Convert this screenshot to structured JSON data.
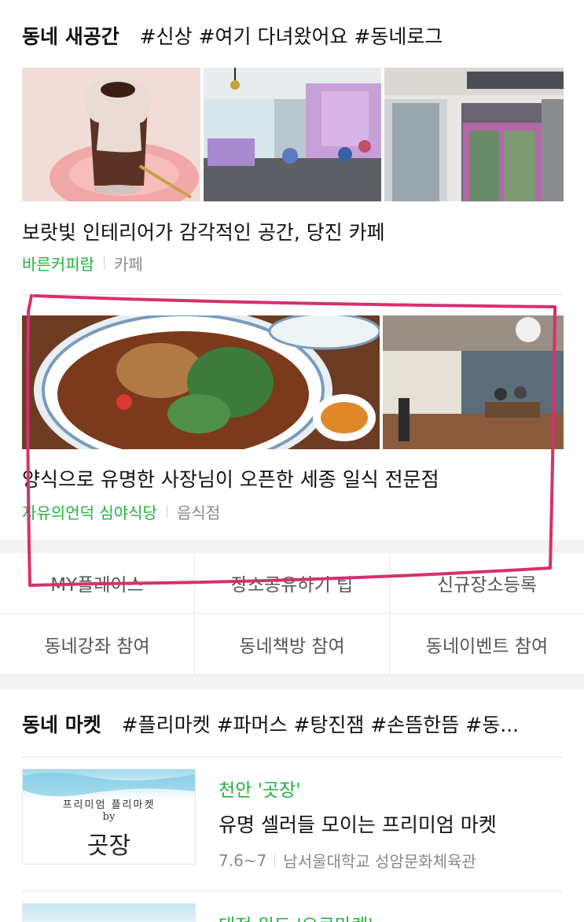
{
  "new_space": {
    "title": "동네 새공간",
    "tags": "#신상 #여기 다녀왔어요 #동네로그",
    "cards": [
      {
        "title": "보랏빛 인테리어가 감각적인 공간, 당진 카페",
        "place": "바른커피람",
        "category": "카페",
        "images": [
          "cafe-drink-photo",
          "purple-interior-photo",
          "storefront-photo"
        ]
      },
      {
        "title": "양식으로 유명한 사장님이 오픈한 세종 일식 전문점",
        "place": "자유의언덕 심야식당",
        "category": "음식점",
        "images": [
          "curry-dish-photo",
          "restaurant-interior-photo"
        ]
      }
    ]
  },
  "menu_grid": {
    "row1": [
      "MY플레이스",
      "장소공유하기 팁",
      "신규장소등록"
    ],
    "row2": [
      "동네강좌 참여",
      "동네책방 참여",
      "동네이벤트 참여"
    ]
  },
  "market": {
    "title": "동네 마켓",
    "tags": "#플리마켓 #파머스 #탕진잼 #손뜸한뜸 #동...",
    "items": [
      {
        "category": "천안 '곳장'",
        "title": "유명 셀러들 모이는 프리미엄 마켓",
        "date": "7.6~7",
        "venue": "남서울대학교 성암문화체육관",
        "thumb_line1": "프리미엄 플리마켓",
        "thumb_line2": "by",
        "thumb_line3": "곳장"
      },
      {
        "category": "대전 원도 '으로마켓'"
      }
    ]
  },
  "colors": {
    "green": "#1fb33a",
    "annotation": "#d6306e"
  }
}
